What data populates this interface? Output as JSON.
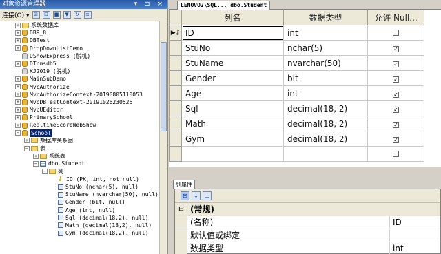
{
  "explorer": {
    "title": "对象资源管理器",
    "title_controls": "▾ ⊐ ×",
    "connect_label": "连接(O) ▾",
    "nodes": [
      {
        "level": 1,
        "expander": "+",
        "icon": "database-icon",
        "label": "系统数据库",
        "folder": true
      },
      {
        "level": 1,
        "expander": "+",
        "icon": "database-icon",
        "label": "DB9_8"
      },
      {
        "level": 1,
        "expander": "+",
        "icon": "database-icon",
        "label": "DBTest"
      },
      {
        "level": 1,
        "expander": "+",
        "icon": "database-icon",
        "label": "DropDownListDemo"
      },
      {
        "level": 1,
        "expander": "",
        "icon": "database-offline-icon",
        "label": "DShowExpress (脱机)"
      },
      {
        "level": 1,
        "expander": "+",
        "icon": "database-icon",
        "label": "DTcmsdb5"
      },
      {
        "level": 1,
        "expander": "",
        "icon": "database-offline-icon",
        "label": "KJ2019 (脱机)"
      },
      {
        "level": 1,
        "expander": "+",
        "icon": "database-icon",
        "label": "MainSubDemo"
      },
      {
        "level": 1,
        "expander": "+",
        "icon": "database-icon",
        "label": "MvcAuthorize"
      },
      {
        "level": 1,
        "expander": "+",
        "icon": "database-icon",
        "label": "MvcAuthorizeContext-20190805110053"
      },
      {
        "level": 1,
        "expander": "+",
        "icon": "database-icon",
        "label": "MvcDBTestContext-20191026230526"
      },
      {
        "level": 1,
        "expander": "+",
        "icon": "database-icon",
        "label": "MvcUEditor"
      },
      {
        "level": 1,
        "expander": "+",
        "icon": "database-icon",
        "label": "PrimarySchool"
      },
      {
        "level": 1,
        "expander": "+",
        "icon": "database-icon",
        "label": "RealtimeScoreWebShow"
      },
      {
        "level": 1,
        "expander": "−",
        "icon": "database-icon",
        "label": "School",
        "selected": true
      },
      {
        "level": 2,
        "expander": "+",
        "icon": "folder-icon",
        "label": "数据库关系图"
      },
      {
        "level": 2,
        "expander": "−",
        "icon": "folder-icon",
        "label": "表"
      },
      {
        "level": 3,
        "expander": "+",
        "icon": "folder-icon",
        "label": "系统表"
      },
      {
        "level": 3,
        "expander": "−",
        "icon": "table-icon",
        "label": "dbo.Student"
      },
      {
        "level": 4,
        "expander": "−",
        "icon": "folder-icon",
        "label": "列"
      },
      {
        "level": 5,
        "expander": "",
        "icon": "key-icon",
        "label": "ID (PK, int, not null)"
      },
      {
        "level": 5,
        "expander": "",
        "icon": "column-icon",
        "label": "StuNo (nchar(5), null)"
      },
      {
        "level": 5,
        "expander": "",
        "icon": "column-icon",
        "label": "StuName (nvarchar(50), null)"
      },
      {
        "level": 5,
        "expander": "",
        "icon": "column-icon",
        "label": "Gender (bit, null)"
      },
      {
        "level": 5,
        "expander": "",
        "icon": "column-icon",
        "label": "Age (int, null)"
      },
      {
        "level": 5,
        "expander": "",
        "icon": "column-icon",
        "label": "Sql (decimal(18,2), null)"
      },
      {
        "level": 5,
        "expander": "",
        "icon": "column-icon",
        "label": "Math (decimal(18,2), null)"
      },
      {
        "level": 5,
        "expander": "",
        "icon": "column-icon",
        "label": "Gym (decimal(18,2), null)"
      }
    ]
  },
  "designer": {
    "tab_label": "LENOVO2\\SQL... dbo.Student",
    "headers": {
      "name": "列名",
      "type": "数据类型",
      "nullable": "允许 Null..."
    },
    "rows": [
      {
        "name": "ID",
        "type": "int",
        "nullable": false,
        "key": true
      },
      {
        "name": "StuNo",
        "type": "nchar(5)",
        "nullable": true
      },
      {
        "name": "StuName",
        "type": "nvarchar(50)",
        "nullable": true
      },
      {
        "name": "Gender",
        "type": "bit",
        "nullable": true
      },
      {
        "name": "Age",
        "type": "int",
        "nullable": true
      },
      {
        "name": "Sql",
        "type": "decimal(18, 2)",
        "nullable": true
      },
      {
        "name": "Math",
        "type": "decimal(18, 2)",
        "nullable": true
      },
      {
        "name": "Gym",
        "type": "decimal(18, 2)",
        "nullable": true
      },
      {
        "name": "",
        "type": "",
        "nullable": false,
        "blank": true
      }
    ]
  },
  "properties": {
    "title": "列属性",
    "category": "(常规)",
    "items": [
      {
        "key": "(名称)",
        "value": "ID"
      },
      {
        "key": "默认值或绑定",
        "value": ""
      },
      {
        "key": "数据类型",
        "value": "int"
      }
    ]
  },
  "colors": {
    "selection": "#0a246a",
    "title_bar": "#2a5aa7",
    "db_icon": "#e8b43a"
  }
}
